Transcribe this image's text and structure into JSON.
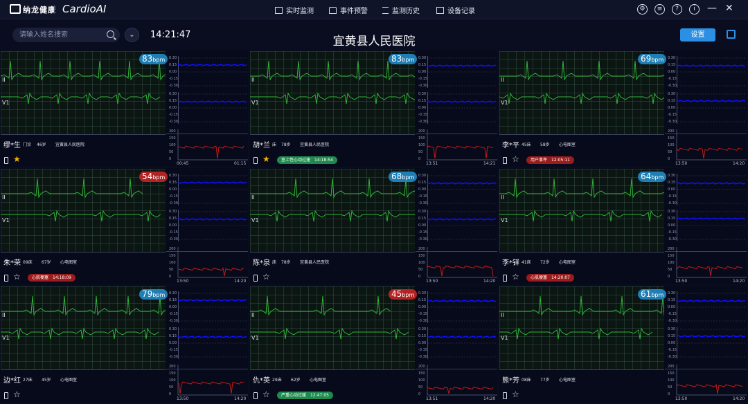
{
  "app": {
    "logo_text": "纳龙健康",
    "title": "CardioAI"
  },
  "nav": [
    {
      "label": "实时监测",
      "icon": "monitor-icon"
    },
    {
      "label": "事件预警",
      "icon": "alert-icon"
    },
    {
      "label": "监测历史",
      "icon": "list-icon"
    },
    {
      "label": "设备记录",
      "icon": "device-icon"
    }
  ],
  "window_controls": [
    "settings-icon",
    "chat-icon",
    "help-icon",
    "info-icon",
    "minimize-icon",
    "close-icon"
  ],
  "toolbar": {
    "search_placeholder": "请输入姓名搜索",
    "clock": "14:21:47",
    "hospital_title": "宜黄县人民医院",
    "settings_button": "设置"
  },
  "colors": {
    "ecg_wave": "#2fb536",
    "st_trace": "#1010ff",
    "hr_trace": "#c81818",
    "bpm_blue": "#1f7eb4",
    "bpm_red": "#b32323",
    "accent": "#2b8fe4"
  },
  "st_ticks": [
    "0.30",
    "0.15",
    "0.00",
    "-0.15",
    "-0.30"
  ],
  "hr_ticks": [
    "200",
    "150",
    "100",
    "50",
    "0"
  ],
  "bpm_unit": "bpm",
  "patients": [
    {
      "name": "缪*生",
      "bed": "门诊",
      "age": "46岁",
      "dept": "宜黄县人民医院",
      "bpm": "83",
      "bpm_alert": false,
      "starred": true,
      "event": "",
      "event_type": "",
      "event_time": "",
      "t_start": "00:45",
      "t_end": "01:15"
    },
    {
      "name": "胡*兰",
      "bed": "床",
      "age": "78岁",
      "dept": "宜黄县人民医院",
      "bpm": "83",
      "bpm_alert": false,
      "starred": true,
      "event": "室上性心动过速",
      "event_type": "green",
      "event_time": "14:18:54",
      "t_start": "13:51",
      "t_end": "14:21"
    },
    {
      "name": "李*平",
      "bed": "45床",
      "age": "58岁",
      "dept": "心电图室",
      "bpm": "69",
      "bpm_alert": false,
      "starred": false,
      "event": "用户事件",
      "event_type": "red",
      "event_time": "12:05:11",
      "t_start": "13:50",
      "t_end": "14:20"
    },
    {
      "name": "朱*荣",
      "bed": "09床",
      "age": "67岁",
      "dept": "心电图室",
      "bpm": "54",
      "bpm_alert": true,
      "starred": false,
      "event": "心肌梗塞",
      "event_type": "red",
      "event_time": "14:18:09",
      "t_start": "13:50",
      "t_end": "14:20"
    },
    {
      "name": "陈*泉",
      "bed": "床",
      "age": "78岁",
      "dept": "宜黄县人民医院",
      "bpm": "68",
      "bpm_alert": false,
      "starred": false,
      "event": "",
      "event_type": "",
      "event_time": "",
      "t_start": "13:50",
      "t_end": "14:20"
    },
    {
      "name": "李*铎",
      "bed": "41床",
      "age": "72岁",
      "dept": "心电图室",
      "bpm": "64",
      "bpm_alert": false,
      "starred": false,
      "event": "心肌梗塞",
      "event_type": "red",
      "event_time": "14:20:07",
      "t_start": "13:50",
      "t_end": "14:20"
    },
    {
      "name": "边*红",
      "bed": "27床",
      "age": "45岁",
      "dept": "心电图室",
      "bpm": "79",
      "bpm_alert": false,
      "starred": false,
      "event": "",
      "event_type": "",
      "event_time": "",
      "t_start": "13:50",
      "t_end": "14:20"
    },
    {
      "name": "仇*英",
      "bed": "29床",
      "age": "62岁",
      "dept": "心电图室",
      "bpm": "45",
      "bpm_alert": true,
      "starred": false,
      "event": "严重心动过缓",
      "event_type": "green",
      "event_time": "12:47:05",
      "t_start": "13:51",
      "t_end": "14:20"
    },
    {
      "name": "熊*芳",
      "bed": "08床",
      "age": "77岁",
      "dept": "心电图室",
      "bpm": "61",
      "bpm_alert": false,
      "starred": false,
      "event": "",
      "event_type": "",
      "event_time": "",
      "t_start": "13:50",
      "t_end": "14:20"
    }
  ]
}
